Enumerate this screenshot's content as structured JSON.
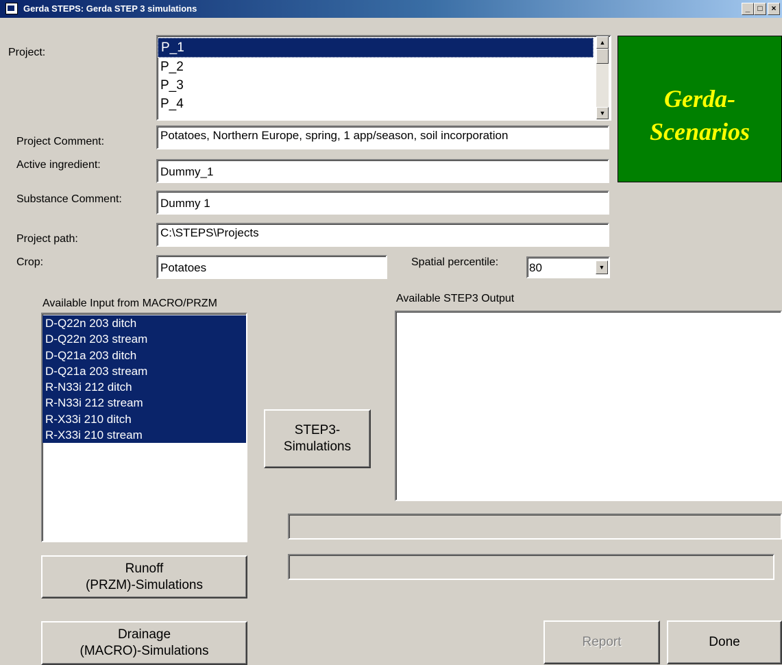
{
  "window": {
    "title": "Gerda STEPS: Gerda STEP 3 simulations",
    "controls": {
      "minimize": "_",
      "maximize": "□",
      "close": "×"
    }
  },
  "project": {
    "label": "Project:",
    "items": [
      "P_1",
      "P_2",
      "P_3",
      "P_4"
    ],
    "selected": "P_1"
  },
  "brand": {
    "line1": "Gerda-",
    "line2": "Scenarios",
    "bg_color": "#008000",
    "text_color": "#ffff00"
  },
  "form": {
    "project_comment": {
      "label": "Project Comment:",
      "value": "Potatoes, Northern Europe, spring, 1 app/season, soil incorporation"
    },
    "active_ingredient": {
      "label": "Active ingredient:",
      "value": "Dummy_1"
    },
    "substance_comment": {
      "label": "Substance Comment:",
      "value": "Dummy 1"
    },
    "project_path": {
      "label": "Project path:",
      "value": "C:\\STEPS\\Projects"
    },
    "crop": {
      "label": "Crop:",
      "value": "Potatoes"
    },
    "spatial_percentile": {
      "label": "Spatial percentile:",
      "value": "80"
    }
  },
  "input_list": {
    "label": "Available Input from MACRO/PRZM",
    "items": [
      "D-Q22n 203  ditch",
      "D-Q22n 203 stream",
      "D-Q21a 203  ditch",
      "D-Q21a 203 stream",
      "R-N33i 212  ditch",
      "R-N33i 212 stream",
      "R-X33i 210  ditch",
      "R-X33i 210 stream"
    ]
  },
  "output_list": {
    "label": "Available STEP3 Output"
  },
  "buttons": {
    "step3": {
      "line1": "STEP3-",
      "line2": "Simulations"
    },
    "runoff": {
      "line1": "Runoff",
      "line2": "(PRZM)-Simulations"
    },
    "drainage": {
      "line1": "Drainage",
      "line2": "(MACRO)-Simulations"
    },
    "report": "Report",
    "done": "Done"
  },
  "colors": {
    "selection": "#0a246a",
    "dialog_bg": "#d4d0c8"
  }
}
